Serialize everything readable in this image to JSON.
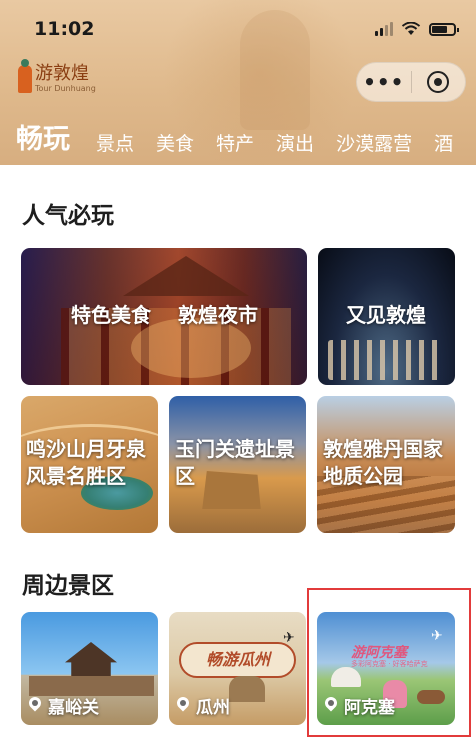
{
  "status_bar": {
    "time": "11:02"
  },
  "logo": {
    "cn": "游敦煌",
    "en": "Tour Dunhuang"
  },
  "tabs": [
    {
      "label": "畅玩",
      "active": true
    },
    {
      "label": "景点"
    },
    {
      "label": "美食"
    },
    {
      "label": "特产"
    },
    {
      "label": "演出"
    },
    {
      "label": "沙漠露营"
    },
    {
      "label": "酒"
    }
  ],
  "sections": {
    "popular": {
      "title": "人气必玩",
      "cards": [
        {
          "label_a": "特色美食",
          "label_b": "敦煌夜市"
        },
        {
          "label": "又见敦煌"
        },
        {
          "label": "鸣沙山月牙泉风景名胜区"
        },
        {
          "label": "玉门关遗址景区"
        },
        {
          "label": "敦煌雅丹国家地质公园"
        }
      ]
    },
    "nearby": {
      "title": "周边景区",
      "cards": [
        {
          "label": "嘉峪关"
        },
        {
          "label": "瓜州",
          "banner": "畅游瓜州"
        },
        {
          "label": "阿克塞",
          "banner": "游阿克塞",
          "banner_sub": "多彩阿克塞 · 好客哈萨克"
        }
      ]
    }
  },
  "colors": {
    "accent": "#d8611f",
    "highlight": "#e23b3b",
    "header": "#dfb98c"
  }
}
